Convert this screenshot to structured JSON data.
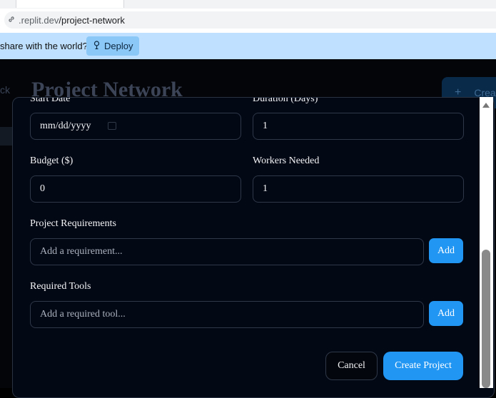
{
  "browser": {
    "url_domain": ".replit.dev",
    "url_path": "/project-network",
    "link_icon": "link-icon"
  },
  "banner": {
    "text": "share with the world?",
    "deploy_label": "Deploy",
    "deploy_icon": "deploy-icon"
  },
  "background": {
    "back_text": "ck",
    "title": "Project Network",
    "create_label": "Crea",
    "create_icon": "plus-icon"
  },
  "form": {
    "start_date_label": "Start Date",
    "start_date_placeholder": "mm/dd/yyyy",
    "duration_label": "Duration (Days)",
    "duration_value": "1",
    "budget_label": "Budget ($)",
    "budget_value": "0",
    "workers_label": "Workers Needed",
    "workers_value": "1",
    "requirements_label": "Project Requirements",
    "requirements_placeholder": "Add a requirement...",
    "requirements_add": "Add",
    "tools_label": "Required Tools",
    "tools_placeholder": "Add a required tool...",
    "tools_add": "Add",
    "cancel_label": "Cancel",
    "create_label": "Create Project"
  },
  "colors": {
    "accent": "#2196f3",
    "modal_bg": "#030815",
    "banner_bg": "#bfe1ff"
  }
}
